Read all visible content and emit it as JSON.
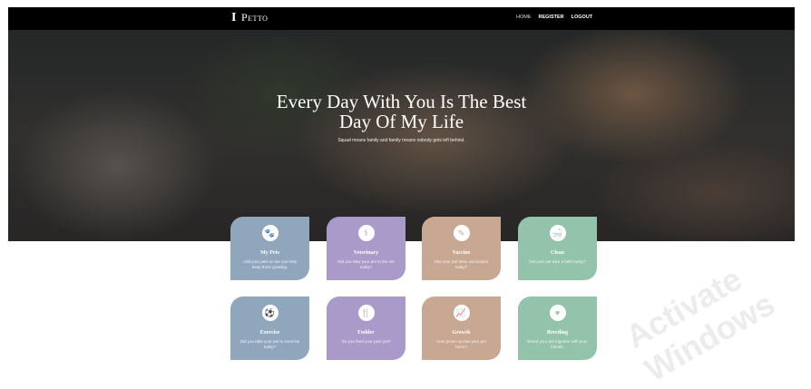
{
  "nav": {
    "brand_mark": "I",
    "brand_name": "Petto",
    "links": [
      "HOME",
      "REGISTER",
      "LOGOUT"
    ]
  },
  "hero": {
    "title_line1": "Every Day With You Is The Best",
    "title_line2": "Day Of My Life",
    "subtitle": "Squad means family and family means nobody gets left behind."
  },
  "cards": [
    {
      "title": "My Pets",
      "desc": "Add your pets so we can help keep them growing.",
      "icon": "paw-icon",
      "glyph": "🐾",
      "color": "#90a6bd"
    },
    {
      "title": "Veterinary",
      "desc": "Did you take your pet to the vet today?",
      "icon": "stethoscope-icon",
      "glyph": "⚕",
      "color": "#a99ac9"
    },
    {
      "title": "Vaccine",
      "desc": "Has your pet been vaccinated today?",
      "icon": "syringe-icon",
      "glyph": "✎",
      "color": "#c8a793"
    },
    {
      "title": "Clean",
      "desc": "Did your pet take a bath today?",
      "icon": "bath-icon",
      "glyph": "🛁",
      "color": "#93c3ab"
    },
    {
      "title": "Exercise",
      "desc": "Did you take your pet to exercise today?",
      "icon": "ball-icon",
      "glyph": "⚽",
      "color": "#90a6bd"
    },
    {
      "title": "Fodder",
      "desc": "Do you feed your pets yet?",
      "icon": "cutlery-icon",
      "glyph": "🍴",
      "color": "#a99ac9"
    },
    {
      "title": "Growth",
      "desc": "How grown up has your pet been?",
      "icon": "chart-icon",
      "glyph": "📈",
      "color": "#c8a793"
    },
    {
      "title": "Breeding",
      "desc": "Breed your pet together with your friends.",
      "icon": "heart-icon",
      "glyph": "♥",
      "color": "#93c3ab"
    }
  ],
  "watermark": "Activate Windows"
}
